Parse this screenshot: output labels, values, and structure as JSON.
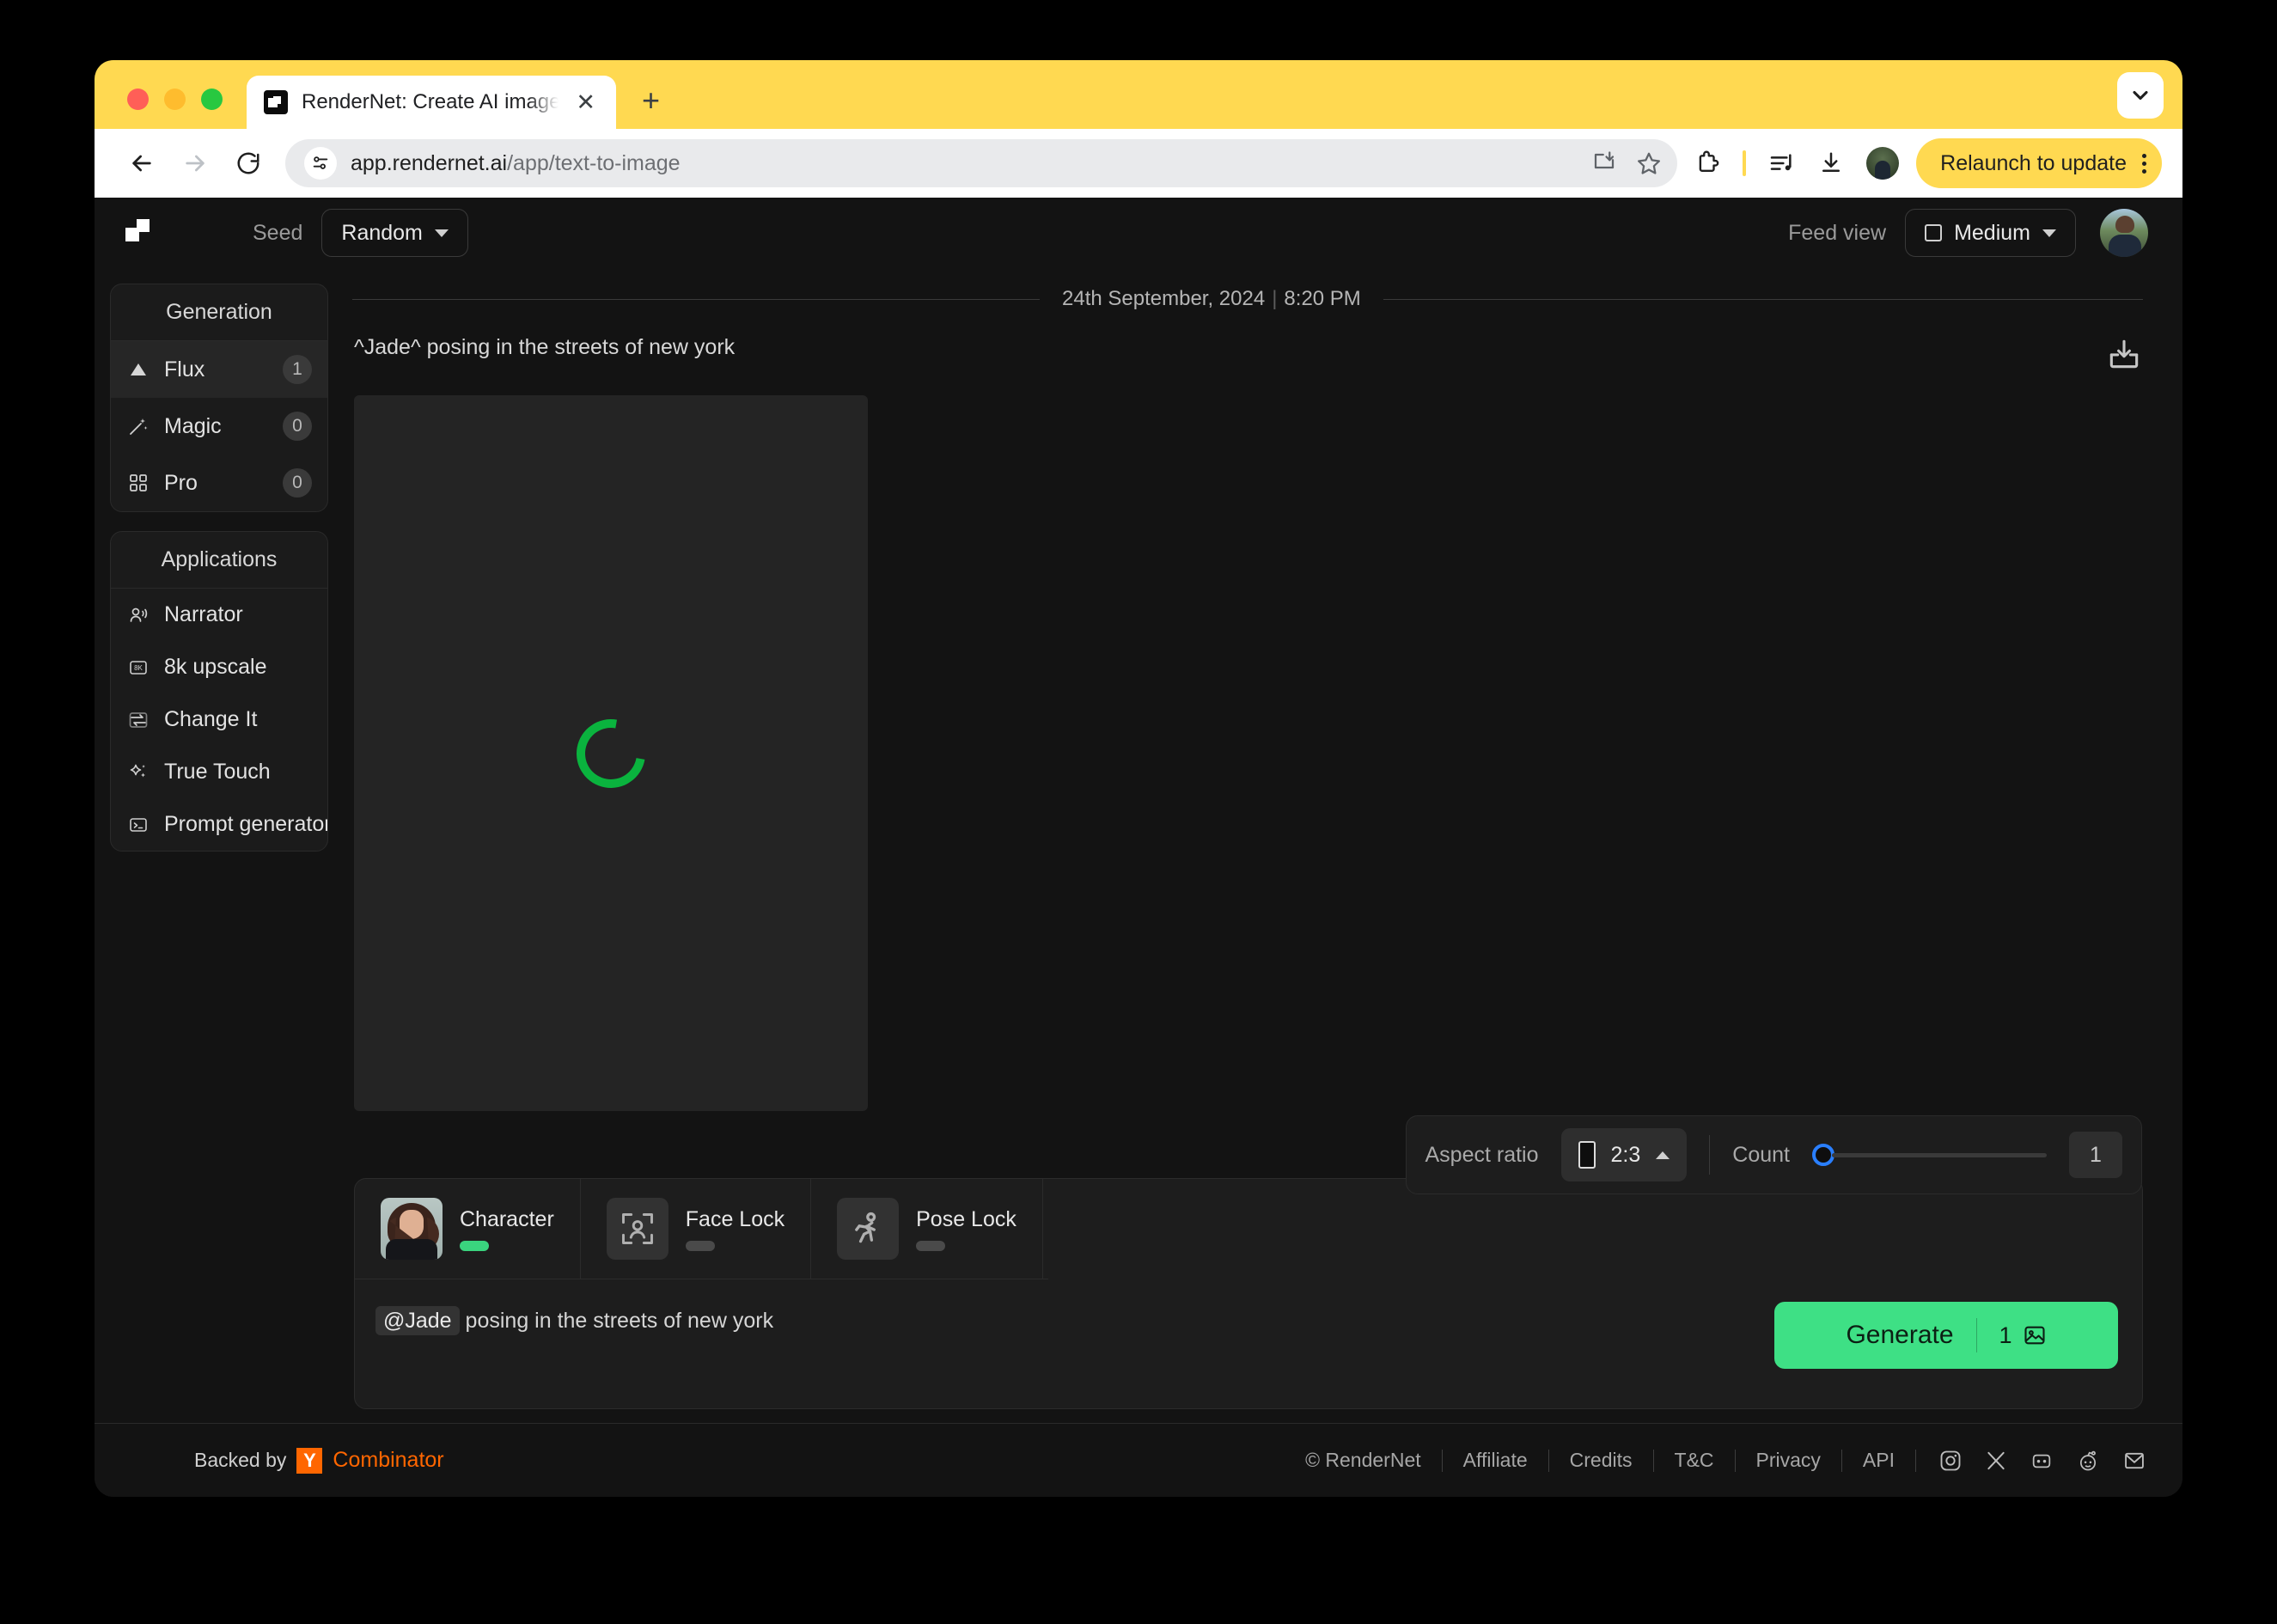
{
  "browser": {
    "tab_title": "RenderNet: Create AI images",
    "close_label": "✕",
    "newtab_label": "+",
    "url_prefix": "app.rendernet.ai",
    "url_suffix": "/app/text-to-image",
    "relaunch_label": "Relaunch to update",
    "back_icon": "←",
    "forward_icon": "→",
    "reload_icon": "⟳",
    "chevron_down": "⌄"
  },
  "header": {
    "seed_label": "Seed",
    "seed_value": "Random",
    "feed_view_label": "Feed view",
    "feed_view_value": "Medium"
  },
  "sidebar": {
    "generation": {
      "title": "Generation",
      "items": [
        {
          "label": "Flux",
          "badge": "1",
          "icon": "triangle-icon",
          "active": true
        },
        {
          "label": "Magic",
          "badge": "0",
          "icon": "wand-icon",
          "active": false
        },
        {
          "label": "Pro",
          "badge": "0",
          "icon": "grid-icon",
          "active": false
        }
      ]
    },
    "applications": {
      "title": "Applications",
      "items": [
        {
          "label": "Narrator",
          "icon": "narrator-icon"
        },
        {
          "label": "8k upscale",
          "icon": "8k-icon"
        },
        {
          "label": "Change It",
          "icon": "swap-icon"
        },
        {
          "label": "True Touch",
          "icon": "sparkle-icon"
        },
        {
          "label": "Prompt generator",
          "icon": "terminal-icon"
        }
      ]
    }
  },
  "feed": {
    "date": "24th September, 2024",
    "time": "8:20 PM",
    "separator": "|",
    "prompt_display": "^Jade^ posing in the streets of new york",
    "download_icon": "download-icon"
  },
  "composer": {
    "locks": [
      {
        "name": "Character",
        "toggle": "on",
        "icon": "character-thumbnail"
      },
      {
        "name": "Face Lock",
        "toggle": "off",
        "icon": "face-lock-icon"
      },
      {
        "name": "Pose Lock",
        "toggle": "off",
        "icon": "pose-lock-icon"
      }
    ],
    "prompt_mention": "@Jade",
    "prompt_rest": "posing in the streets of new york",
    "generate_label": "Generate",
    "generate_count": "1",
    "aspect_ratio_label": "Aspect ratio",
    "aspect_ratio_value": "2:3",
    "count_label": "Count",
    "count_value": "1"
  },
  "footer": {
    "backed_by": "Backed by",
    "yc_mark": "Y",
    "yc_word": "Combinator",
    "links": [
      "© RenderNet",
      "Affiliate",
      "Credits",
      "T&C",
      "Privacy",
      "API"
    ],
    "socials": [
      "instagram-icon",
      "x-icon",
      "discord-icon",
      "reddit-icon",
      "email-icon"
    ]
  },
  "colors": {
    "brand_yellow": "#ffd951",
    "accent_green": "#3ee085",
    "spinner_green": "#0ab33e",
    "slider_blue": "#2a7fff",
    "yc_orange": "#ff6600"
  }
}
